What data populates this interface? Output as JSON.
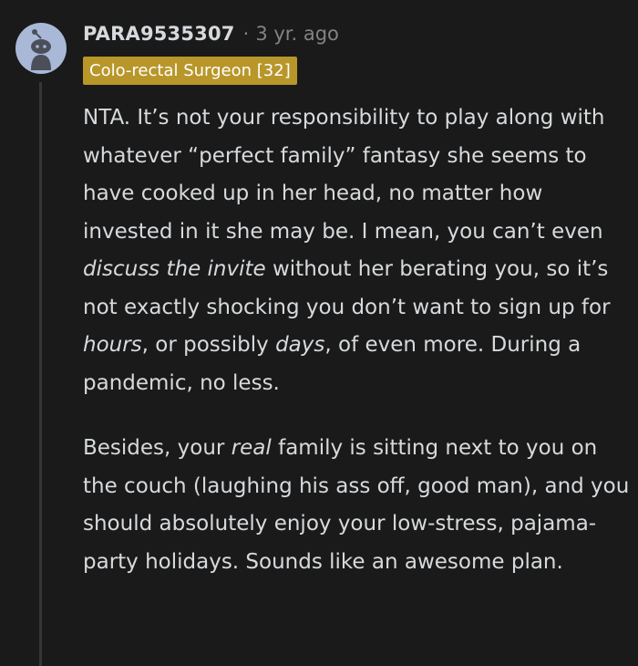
{
  "comment": {
    "username": "PARA9535307",
    "separator": "·",
    "timestamp": "3 yr. ago",
    "flair": "Colo-rectal Surgeon [32]",
    "paragraphs": [
      [
        {
          "text": "NTA. It’s not your responsibility to play along with whatever “perfect family” fantasy she seems to have cooked up in her head, no matter how invested in it she may be. I mean, you can’t even ",
          "italic": false
        },
        {
          "text": "discuss the invite",
          "italic": true
        },
        {
          "text": " without her berating you, so it’s not exactly shocking you don’t want to sign up for ",
          "italic": false
        },
        {
          "text": "hours",
          "italic": true
        },
        {
          "text": ", or possibly ",
          "italic": false
        },
        {
          "text": "days",
          "italic": true
        },
        {
          "text": ", of even more. During a pandemic, no less.",
          "italic": false
        }
      ],
      [
        {
          "text": "Besides, your ",
          "italic": false
        },
        {
          "text": "real",
          "italic": true
        },
        {
          "text": " family is sitting next to you on the couch (laughing his ass off, good man), and you should absolutely enjoy your low-stress, pajama-party holidays. Sounds like an awesome plan.",
          "italic": false
        }
      ]
    ]
  },
  "avatar": {
    "icon": "reddit-snoo-avatar-icon",
    "background": "#a9b8d6",
    "figure_color": "#4a4f5a"
  },
  "colors": {
    "background": "#1a1a1b",
    "text": "#d7dadc",
    "muted": "#818384",
    "flair_bg": "#b8962a",
    "flair_text": "#ffffff",
    "thread_line": "#343536"
  }
}
